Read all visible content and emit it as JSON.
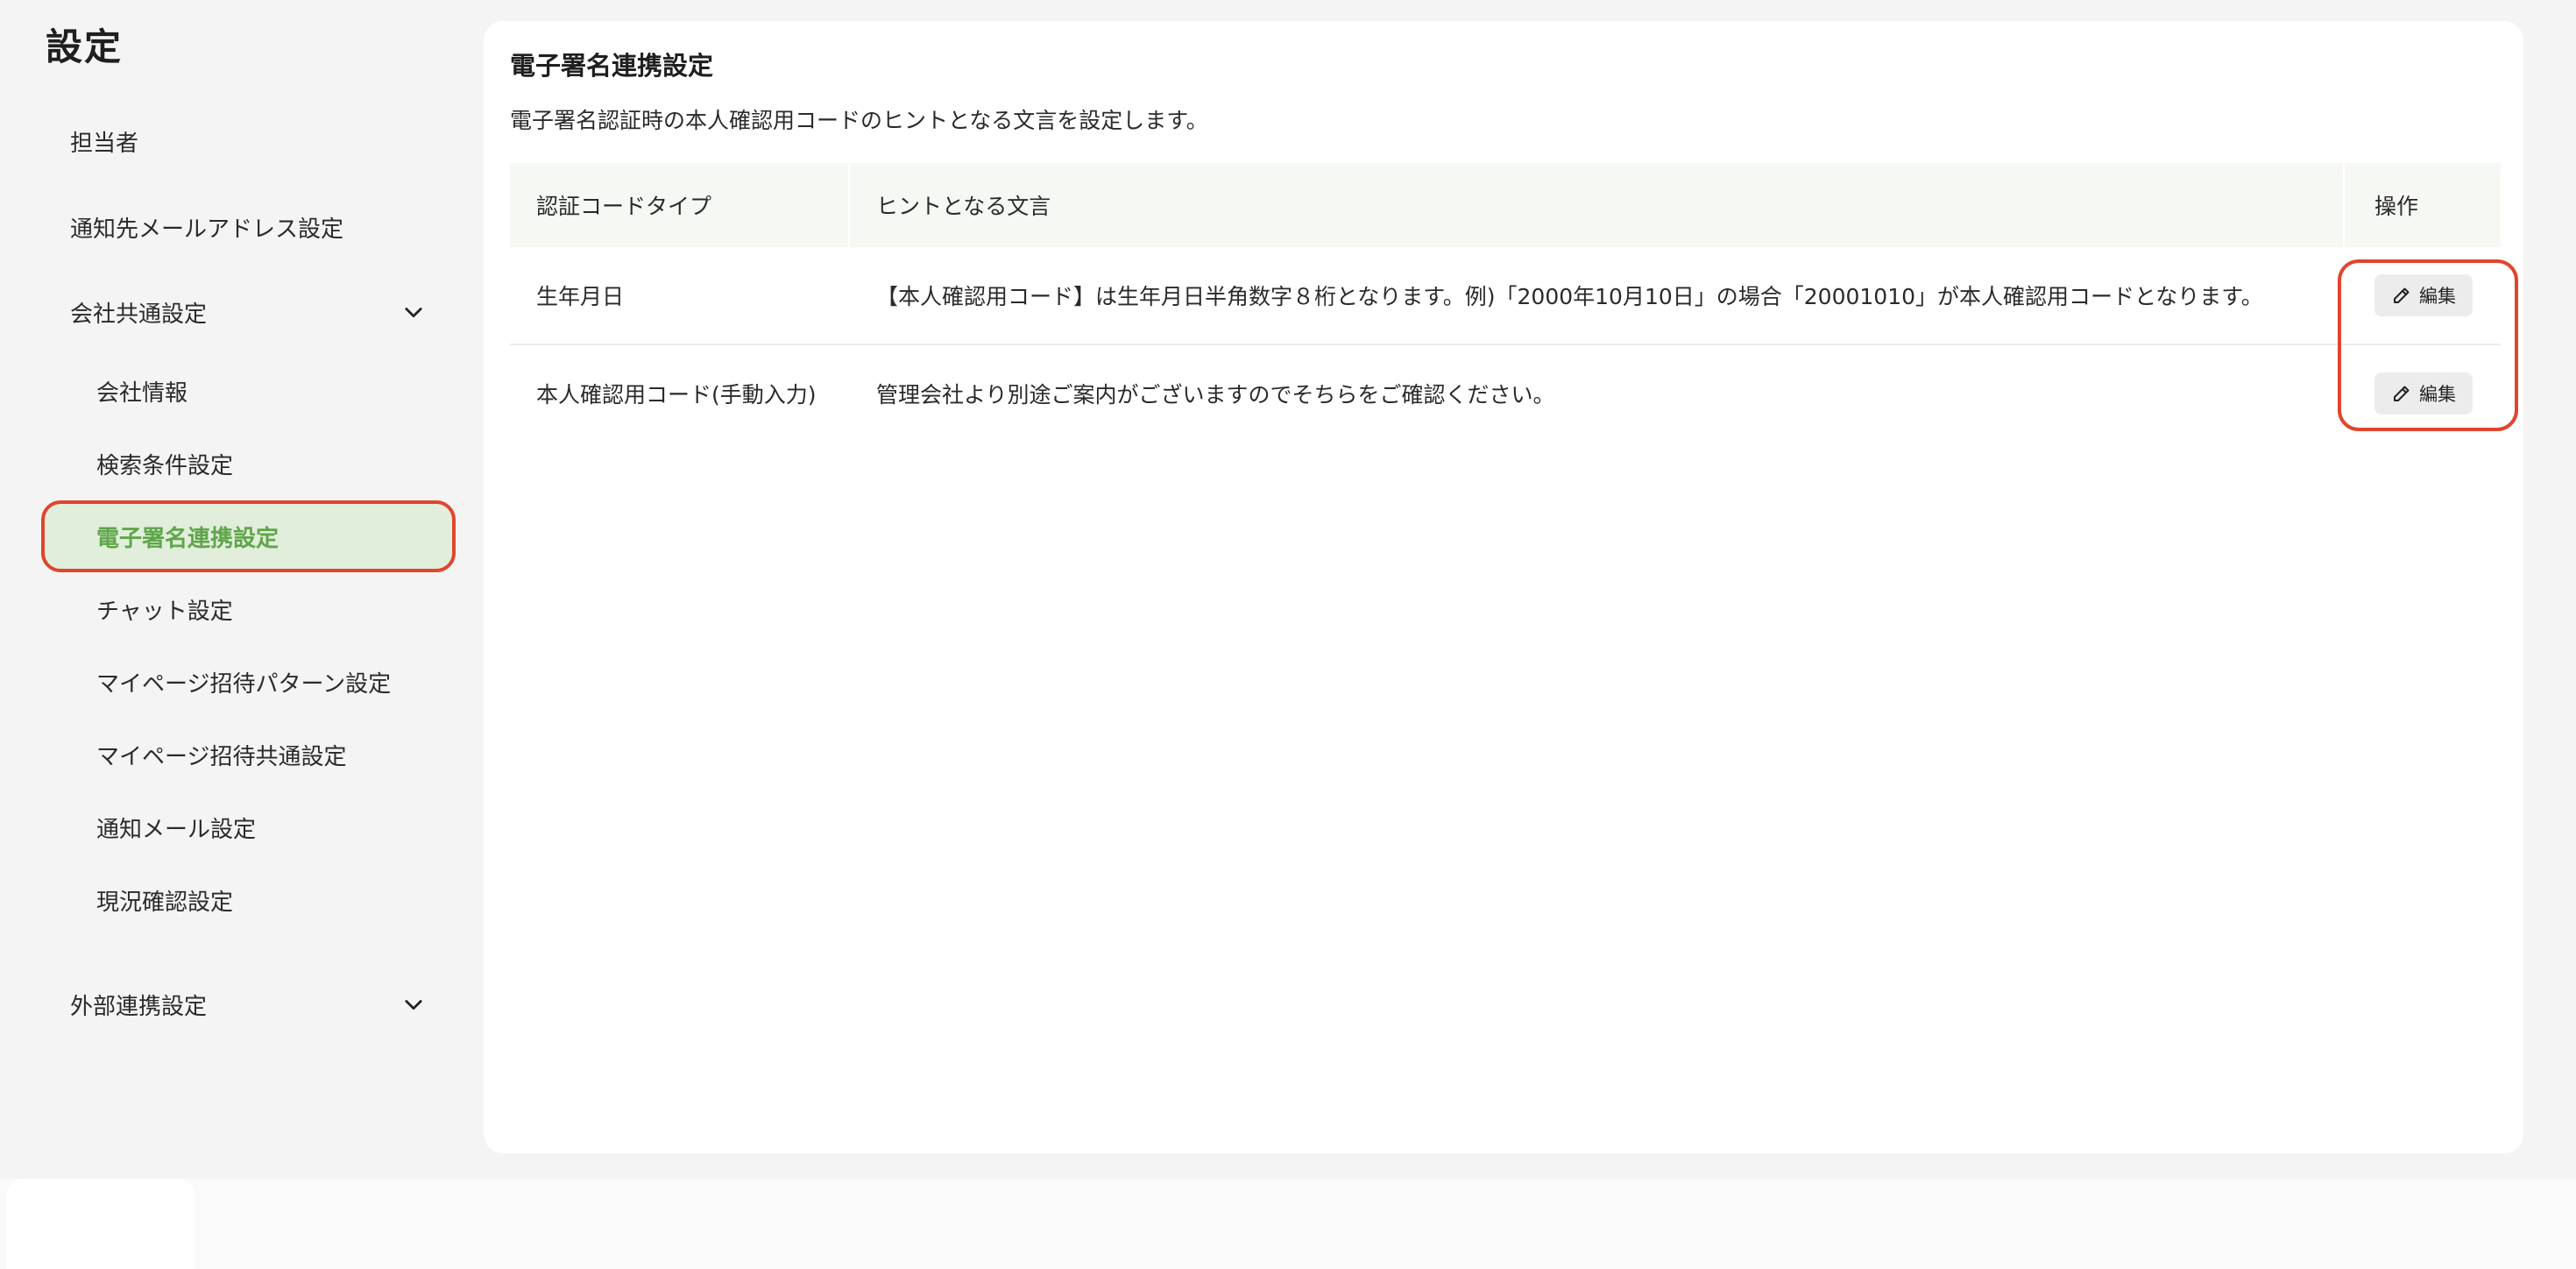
{
  "page": {
    "title": "設定"
  },
  "sidebar": {
    "items": [
      {
        "label": "担当者"
      },
      {
        "label": "通知先メールアドレス設定"
      },
      {
        "label": "会社共通設定"
      },
      {
        "label": "会社情報"
      },
      {
        "label": "検索条件設定"
      },
      {
        "label": "電子署名連携設定"
      },
      {
        "label": "チャット設定"
      },
      {
        "label": "マイページ招待パターン設定"
      },
      {
        "label": "マイページ招待共通設定"
      },
      {
        "label": "通知メール設定"
      },
      {
        "label": "現況確認設定"
      },
      {
        "label": "外部連携設定"
      }
    ],
    "active": "電子署名連携設定"
  },
  "main": {
    "title": "電子署名連携設定",
    "description": "電子署名認証時の本人確認用コードのヒントとなる文言を設定します。",
    "table": {
      "headers": [
        "認証コードタイプ",
        "ヒントとなる文言",
        "操作"
      ],
      "rows": [
        {
          "type": "生年月日",
          "hint": "【本人確認用コード】は生年月日半角数字８桁となります。例)「2000年10月10日」の場合「20001010」が本人確認用コードとなります。",
          "action": "編集"
        },
        {
          "type": "本人確認用コード(手動入力)",
          "hint": "管理会社より別途ご案内がございますのでそちらをご確認ください。",
          "action": "編集"
        }
      ]
    }
  },
  "colors": {
    "accent": "#5fa64a",
    "active_bg": "#e1eedb",
    "highlight": "#e0452d",
    "page_bg": "#f4f4f4",
    "card_bg": "#ffffff",
    "table_header_bg": "#f6f8f4",
    "button_bg": "#ececec"
  },
  "icons": {
    "expand": "chevron-down-icon",
    "edit": "pencil-icon"
  }
}
